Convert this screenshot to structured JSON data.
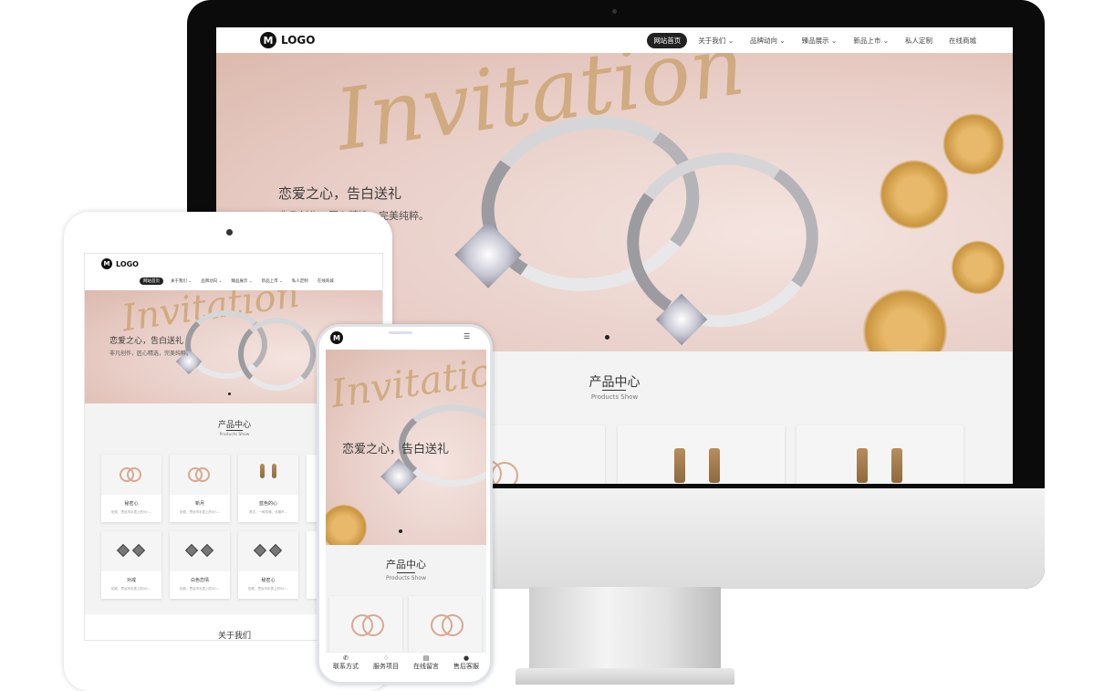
{
  "site": {
    "logo_text": "LOGO",
    "logo_letter": "M",
    "nav": [
      "网站首页",
      "关于我们 ⌄",
      "品牌动向 ⌄",
      "臻品展示 ⌄",
      "新品上市 ⌄",
      "私人定制",
      "在线商城"
    ],
    "hero_script": "Invitation",
    "hero_title": "恋爱之心，告白送礼",
    "hero_subtitle": "非凡创作，匠心精选，完美纯粹。",
    "products_title": "产品中心",
    "products_subtitle": "Products Show",
    "about_title": "关于我们",
    "products": [
      {
        "name": "秘密心",
        "desc": "铂戒，思远市手表上的5小..."
      },
      {
        "name": "新月",
        "desc": "铂戒，思远市手表上的5小..."
      },
      {
        "name": "蓝色的心",
        "desc": "再生，一种恋情，长期市..."
      },
      {
        "name": "对戒",
        "desc": "铂戒，思远市手表上的5小..."
      },
      {
        "name": "白色恋情",
        "desc": "铂戒，思远市手表上的5小..."
      },
      {
        "name": "秘密心",
        "desc": "铂戒，思远市手表上的5小..."
      }
    ]
  },
  "phone_tabbar": [
    {
      "icon": "phone-icon",
      "glyph": "✆",
      "label": "联系方式"
    },
    {
      "icon": "diamond-icon",
      "glyph": "♢",
      "label": "服务项目"
    },
    {
      "icon": "message-icon",
      "glyph": "▤",
      "label": "在线留言"
    },
    {
      "icon": "bell-icon",
      "glyph": "●",
      "label": "售后客服"
    }
  ],
  "colors": {
    "nav_active": "#222222",
    "accent_gold": "#c9a06a",
    "background": "#f3f3f3"
  }
}
